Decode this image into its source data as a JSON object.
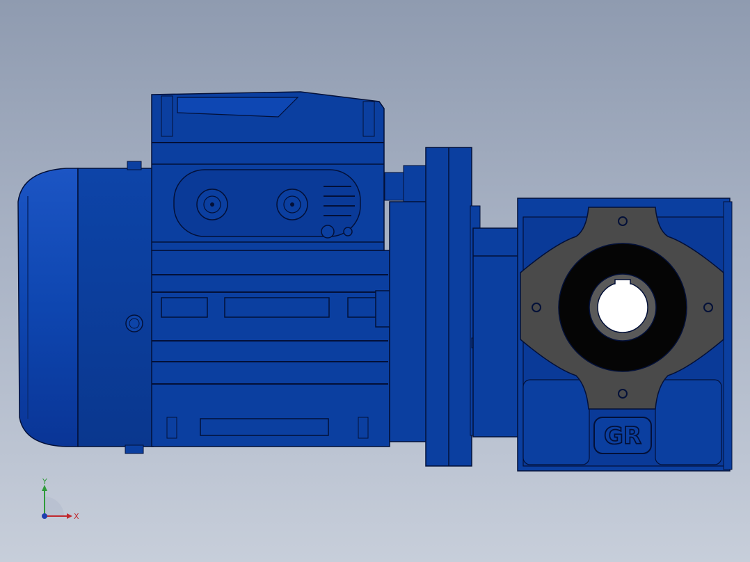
{
  "viewport": {
    "background_top": "#8f9bb0",
    "background_bottom": "#c7ceda"
  },
  "model": {
    "body_color": "#0b3fa0",
    "dark_color": "#061f66",
    "edge_color": "#031038",
    "flange_color": "#4a4a4a",
    "gearbox_logo_text": "GR"
  },
  "triad": {
    "x_label": "X",
    "y_label": "Y",
    "x_color": "#c0282d",
    "y_color": "#2f9b3a",
    "z_color": "#1f3fb0"
  }
}
